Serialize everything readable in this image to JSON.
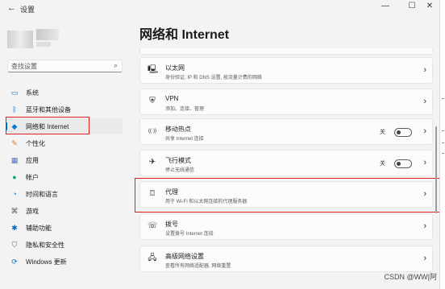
{
  "window": {
    "title": "设置",
    "back_glyph": "←",
    "min_glyph": "—",
    "max_glyph": "☐",
    "close_glyph": "✕"
  },
  "search": {
    "placeholder": "查找设置"
  },
  "sidebar": {
    "items": [
      {
        "label": "系统",
        "icon": "monitor-icon",
        "color": "#0078d4",
        "glyph": "▭"
      },
      {
        "label": "蓝牙和其他设备",
        "icon": "bluetooth-icon",
        "color": "#0067c0",
        "glyph": "ᛒ"
      },
      {
        "label": "网络和 Internet",
        "icon": "wifi-diamond-icon",
        "color": "#0078d4",
        "glyph": "◆",
        "selected": true
      },
      {
        "label": "个性化",
        "icon": "brush-icon",
        "color": "#e07a2c",
        "glyph": "✎"
      },
      {
        "label": "应用",
        "icon": "apps-icon",
        "color": "#5c6bc0",
        "glyph": "▦"
      },
      {
        "label": "帐户",
        "icon": "person-icon",
        "color": "#1aa260",
        "glyph": "●"
      },
      {
        "label": "时间和语言",
        "icon": "globe-clock-icon",
        "color": "#0078d4",
        "glyph": "◔"
      },
      {
        "label": "游戏",
        "icon": "gamepad-icon",
        "color": "#555555",
        "glyph": "⌘"
      },
      {
        "label": "辅助功能",
        "icon": "accessibility-icon",
        "color": "#0067c0",
        "glyph": "✱"
      },
      {
        "label": "隐私和安全性",
        "icon": "shield-icon",
        "color": "#6b6b6b",
        "glyph": "⛉"
      },
      {
        "label": "Windows 更新",
        "icon": "update-icon",
        "color": "#0078d4",
        "glyph": "⟳"
      }
    ]
  },
  "main": {
    "title": "网络和 Internet",
    "cards": [
      {
        "title": "以太网",
        "subtitle": "身份验证, IP 和 DNS 设置, 按流量计费的网络",
        "icon": "ethernet-icon",
        "glyph": "🖳",
        "chevron": "›"
      },
      {
        "title": "VPN",
        "subtitle": "添加、连接、管理",
        "icon": "vpn-shield-icon",
        "glyph": "⛨",
        "chevron": "›"
      },
      {
        "title": "移动热点",
        "subtitle": "共享 Internet 连接",
        "icon": "hotspot-icon",
        "glyph": "((·))",
        "chevron": "›",
        "toggle_label": "关",
        "toggle_on": false
      },
      {
        "title": "飞行模式",
        "subtitle": "停止无线通信",
        "icon": "airplane-icon",
        "glyph": "✈",
        "chevron": "›",
        "toggle_label": "关",
        "toggle_on": false
      },
      {
        "title": "代理",
        "subtitle": "用于 Wi-Fi 和以太网连接的代理服务器",
        "icon": "proxy-icon",
        "glyph": "⌼",
        "chevron": "›"
      },
      {
        "title": "拨号",
        "subtitle": "设置拨号 Internet 连接",
        "icon": "dialup-icon",
        "glyph": "☏",
        "chevron": "›"
      },
      {
        "title": "高级网络设置",
        "subtitle": "查看所有网络适配器, 网络重置",
        "icon": "network-adapter-icon",
        "glyph": "🖧",
        "chevron": "›"
      }
    ]
  },
  "watermark": "CSDN @WW|阿",
  "colors": {
    "accent": "#0067c0",
    "highlight": "#e02020"
  }
}
